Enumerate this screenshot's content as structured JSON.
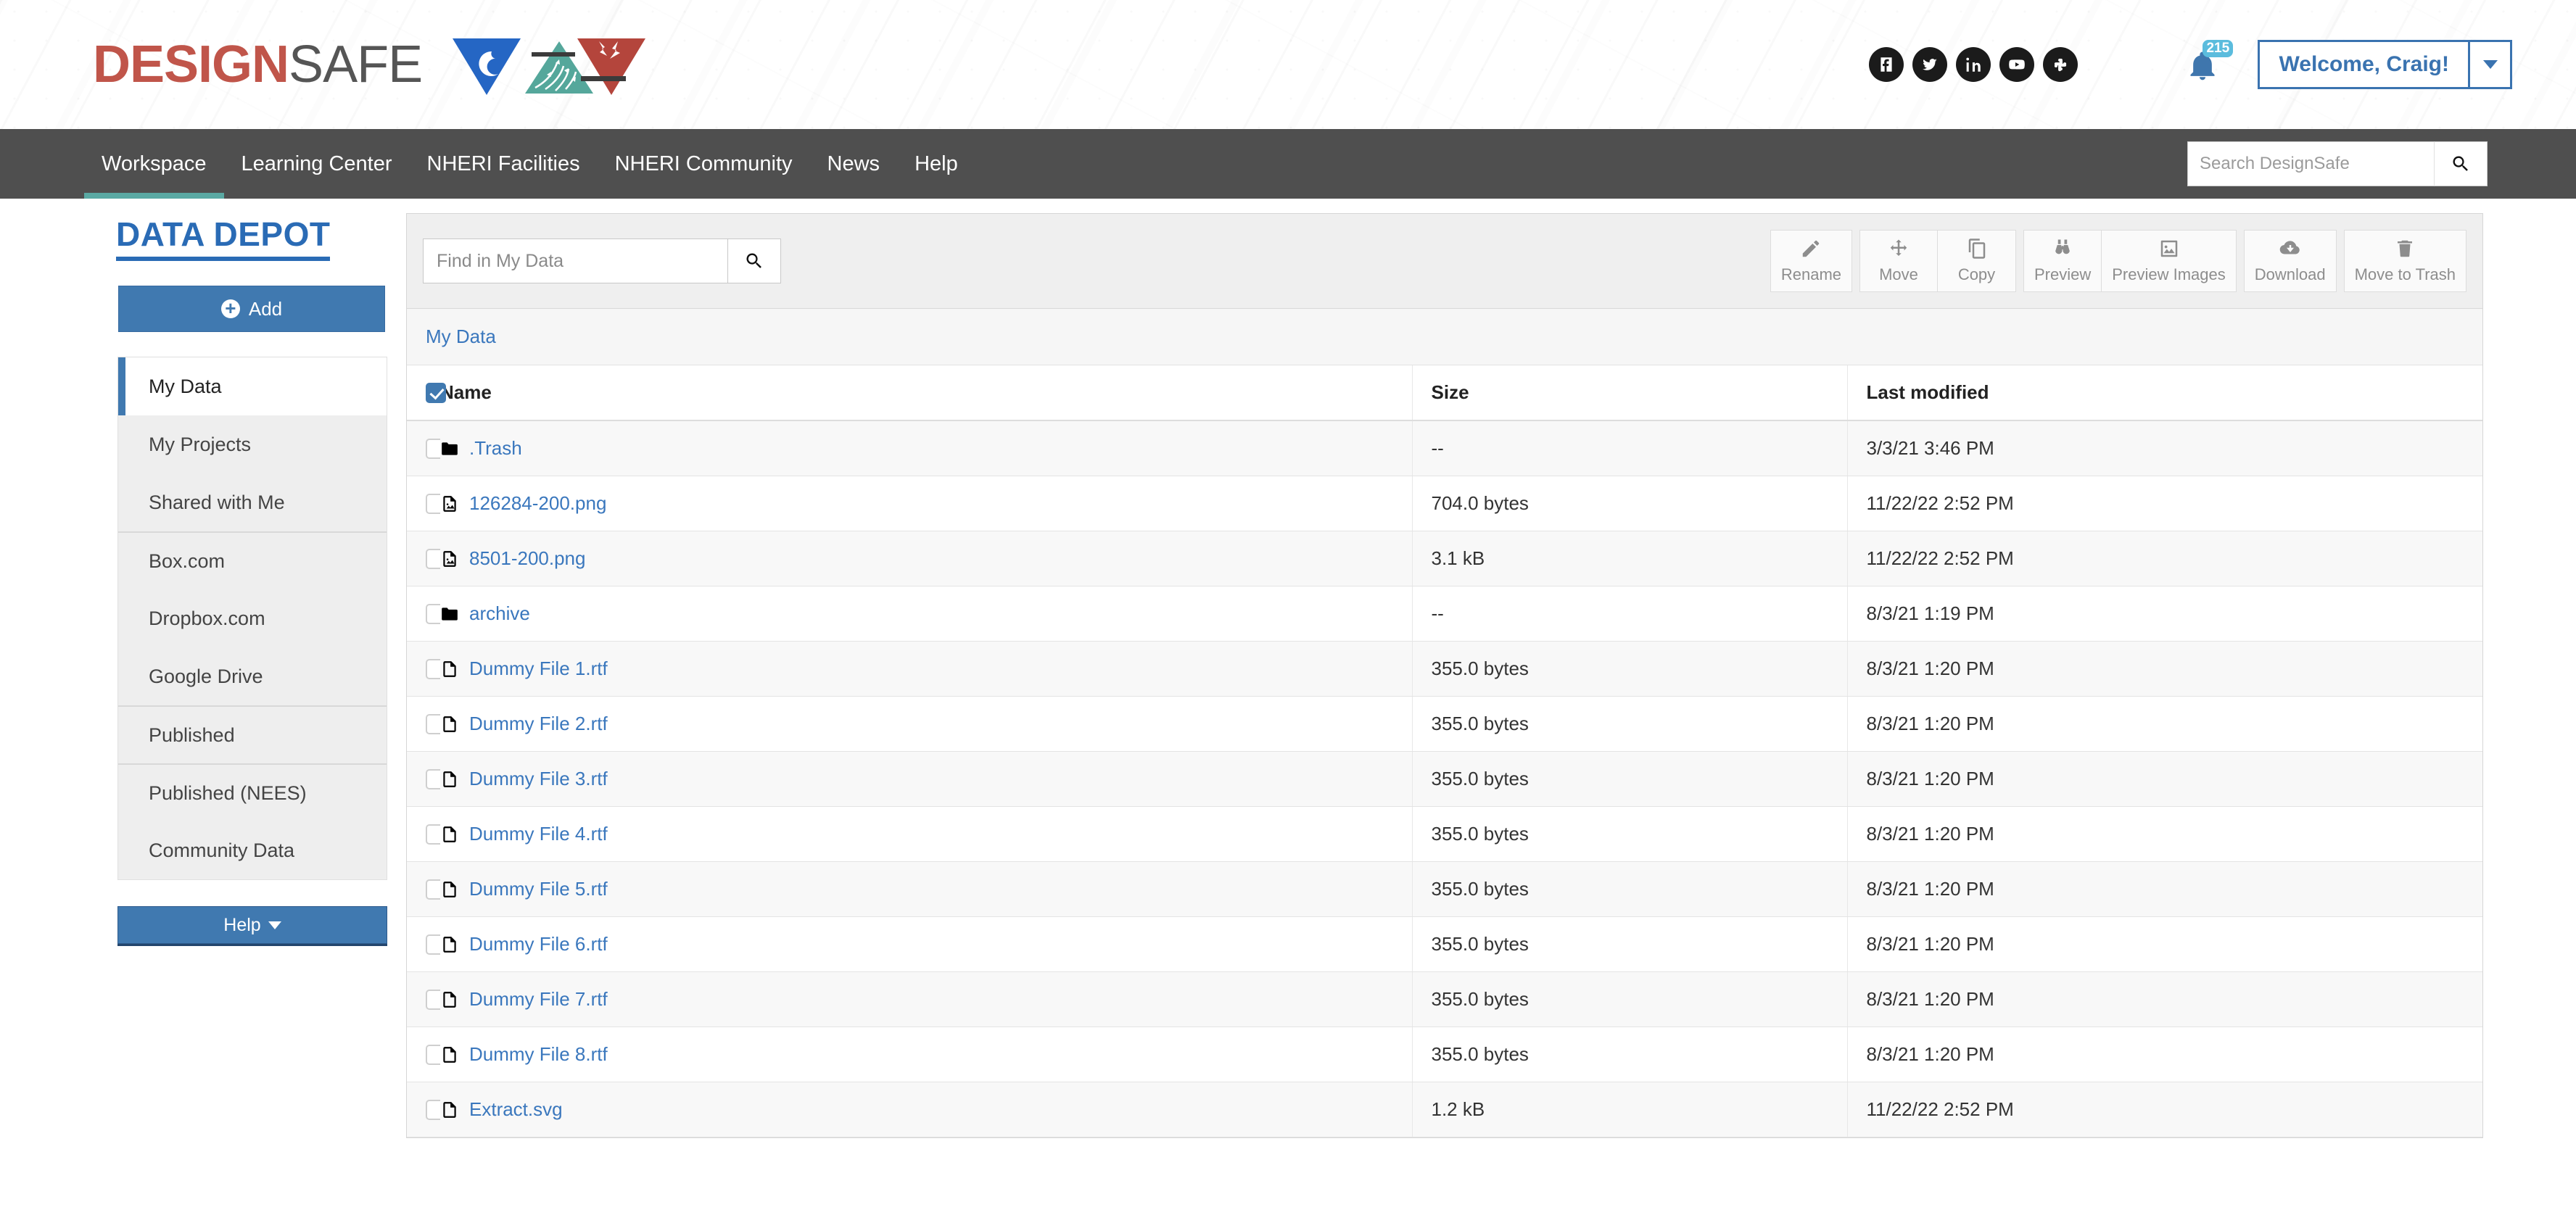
{
  "brand": {
    "logo_primary": "DESIGN",
    "logo_secondary": "SAFE",
    "logo_mark_name": "nheri-triangles-logo",
    "brand_red": "#c0554a",
    "brand_blue": "#2a6bb5",
    "brand_teal": "#5aa9a3"
  },
  "social": [
    {
      "name": "facebook-icon",
      "label": "Facebook"
    },
    {
      "name": "twitter-icon",
      "label": "Twitter"
    },
    {
      "name": "linkedin-icon",
      "label": "LinkedIn"
    },
    {
      "name": "youtube-icon",
      "label": "YouTube"
    },
    {
      "name": "slack-icon",
      "label": "Slack"
    }
  ],
  "notifications": {
    "count": "215"
  },
  "account": {
    "welcome_label": "Welcome, Craig!"
  },
  "nav": {
    "items": [
      {
        "label": "Workspace",
        "active": true
      },
      {
        "label": "Learning Center",
        "active": false
      },
      {
        "label": "NHERI Facilities",
        "active": false
      },
      {
        "label": "NHERI Community",
        "active": false
      },
      {
        "label": "News",
        "active": false
      },
      {
        "label": "Help",
        "active": false
      }
    ],
    "search_placeholder": "Search DesignSafe",
    "search_value": ""
  },
  "sidebar": {
    "title": "DATA DEPOT",
    "add_label": "Add",
    "help_label": "Help",
    "items": [
      {
        "label": "My Data",
        "active": true,
        "group_start": false
      },
      {
        "label": "My Projects",
        "active": false,
        "group_start": false
      },
      {
        "label": "Shared with Me",
        "active": false,
        "group_start": false
      },
      {
        "label": "Box.com",
        "active": false,
        "group_start": true
      },
      {
        "label": "Dropbox.com",
        "active": false,
        "group_start": false
      },
      {
        "label": "Google Drive",
        "active": false,
        "group_start": false
      },
      {
        "label": "Published",
        "active": false,
        "group_start": true
      },
      {
        "label": "Published (NEES)",
        "active": false,
        "group_start": true
      },
      {
        "label": "Community Data",
        "active": false,
        "group_start": false
      }
    ]
  },
  "toolbar": {
    "find_placeholder": "Find in My Data",
    "find_value": "",
    "actions": [
      {
        "label": "Rename",
        "icon": "pencil-icon"
      },
      {
        "label": "Move",
        "icon": "move-arrows-icon"
      },
      {
        "label": "Copy",
        "icon": "copy-files-icon"
      },
      {
        "label": "Preview",
        "icon": "binoculars-icon"
      },
      {
        "label": "Preview Images",
        "icon": "image-icon"
      },
      {
        "label": "Download",
        "icon": "cloud-download-icon"
      },
      {
        "label": "Move to Trash",
        "icon": "trash-icon"
      }
    ]
  },
  "breadcrumb": {
    "items": [
      "My Data"
    ]
  },
  "table": {
    "select_all_checked": true,
    "columns": [
      "Name",
      "Size",
      "Last modified"
    ],
    "rows": [
      {
        "name": ".Trash",
        "type": "folder",
        "size": "--",
        "modified": "3/3/21 3:46 PM",
        "checked": false
      },
      {
        "name": "126284-200.png",
        "type": "image",
        "size": "704.0 bytes",
        "modified": "11/22/22 2:52 PM",
        "checked": false
      },
      {
        "name": "8501-200.png",
        "type": "image",
        "size": "3.1 kB",
        "modified": "11/22/22 2:52 PM",
        "checked": false
      },
      {
        "name": "archive",
        "type": "folder",
        "size": "--",
        "modified": "8/3/21 1:19 PM",
        "checked": false
      },
      {
        "name": "Dummy File 1.rtf",
        "type": "document",
        "size": "355.0 bytes",
        "modified": "8/3/21 1:20 PM",
        "checked": false
      },
      {
        "name": "Dummy File 2.rtf",
        "type": "document",
        "size": "355.0 bytes",
        "modified": "8/3/21 1:20 PM",
        "checked": false
      },
      {
        "name": "Dummy File 3.rtf",
        "type": "document",
        "size": "355.0 bytes",
        "modified": "8/3/21 1:20 PM",
        "checked": false
      },
      {
        "name": "Dummy File 4.rtf",
        "type": "document",
        "size": "355.0 bytes",
        "modified": "8/3/21 1:20 PM",
        "checked": false
      },
      {
        "name": "Dummy File 5.rtf",
        "type": "document",
        "size": "355.0 bytes",
        "modified": "8/3/21 1:20 PM",
        "checked": false
      },
      {
        "name": "Dummy File 6.rtf",
        "type": "document",
        "size": "355.0 bytes",
        "modified": "8/3/21 1:20 PM",
        "checked": false
      },
      {
        "name": "Dummy File 7.rtf",
        "type": "document",
        "size": "355.0 bytes",
        "modified": "8/3/21 1:20 PM",
        "checked": false
      },
      {
        "name": "Dummy File 8.rtf",
        "type": "document",
        "size": "355.0 bytes",
        "modified": "8/3/21 1:20 PM",
        "checked": false
      },
      {
        "name": "Extract.svg",
        "type": "document",
        "size": "1.2 kB",
        "modified": "11/22/22 2:52 PM",
        "checked": false
      }
    ]
  }
}
